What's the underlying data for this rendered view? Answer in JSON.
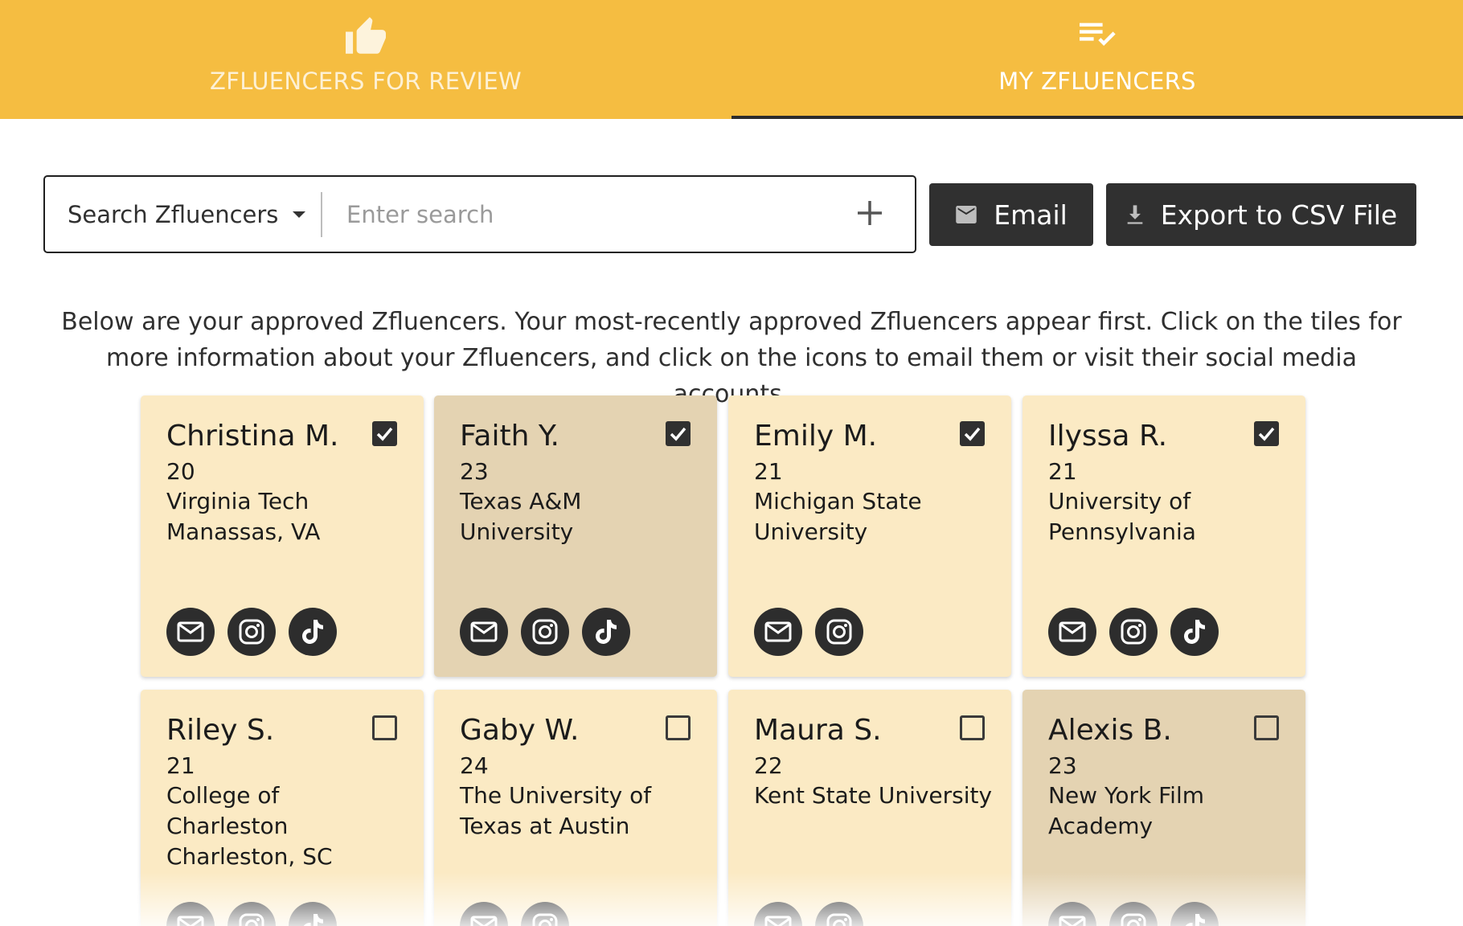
{
  "tabs": [
    {
      "label": "ZFLUENCERS FOR REVIEW",
      "icon": "thumbs-up-icon",
      "active": false
    },
    {
      "label": "MY ZFLUENCERS",
      "icon": "playlist-check-icon",
      "active": true
    }
  ],
  "search": {
    "filter_label": "Search Zfluencers",
    "placeholder": "Enter search",
    "value": ""
  },
  "toolbar": {
    "email_label": "Email",
    "export_label": "Export to CSV File"
  },
  "intro_text": "Below are your approved Zfluencers. Your most-recently approved Zfluencers appear first. Click on the tiles for more information about your Zfluencers, and click on the icons to email them or visit their social media accounts.",
  "colors": {
    "header": "#f5bd41",
    "card_light": "#fbeac4",
    "card_dark": "#e4d3b2",
    "button_dark": "#303030"
  },
  "cards": [
    {
      "name": "Christina M.",
      "age": "20",
      "school": "Virginia Tech",
      "location": "Manassas, VA",
      "checked": true,
      "shade": "light",
      "icons": [
        "email-icon",
        "instagram-icon",
        "tiktok-icon"
      ]
    },
    {
      "name": "Faith Y.",
      "age": "23",
      "school": "Texas A&M University",
      "location": "",
      "checked": true,
      "shade": "dark",
      "icons": [
        "email-icon",
        "instagram-icon",
        "tiktok-icon"
      ]
    },
    {
      "name": "Emily M.",
      "age": "21",
      "school": "Michigan State University",
      "location": "",
      "checked": true,
      "shade": "light",
      "icons": [
        "email-icon",
        "instagram-icon"
      ]
    },
    {
      "name": "Ilyssa R.",
      "age": "21",
      "school": "University of Pennsylvania",
      "location": "",
      "checked": true,
      "shade": "light",
      "icons": [
        "email-icon",
        "instagram-icon",
        "tiktok-icon"
      ]
    },
    {
      "name": "Riley S.",
      "age": "21",
      "school": "College of Charleston",
      "location": "Charleston, SC",
      "checked": false,
      "shade": "light",
      "icons": [
        "email-icon",
        "instagram-icon",
        "tiktok-icon"
      ]
    },
    {
      "name": "Gaby W.",
      "age": "24",
      "school": "The University of Texas at Austin",
      "location": "",
      "checked": false,
      "shade": "light",
      "icons": [
        "email-icon",
        "instagram-icon"
      ]
    },
    {
      "name": "Maura S.",
      "age": "22",
      "school": "Kent State University",
      "location": "",
      "checked": false,
      "shade": "light",
      "icons": [
        "email-icon",
        "instagram-icon"
      ]
    },
    {
      "name": "Alexis B.",
      "age": "23",
      "school": "New York Film Academy",
      "location": "",
      "checked": false,
      "shade": "dark",
      "icons": [
        "email-icon",
        "instagram-icon",
        "tiktok-icon"
      ]
    }
  ]
}
